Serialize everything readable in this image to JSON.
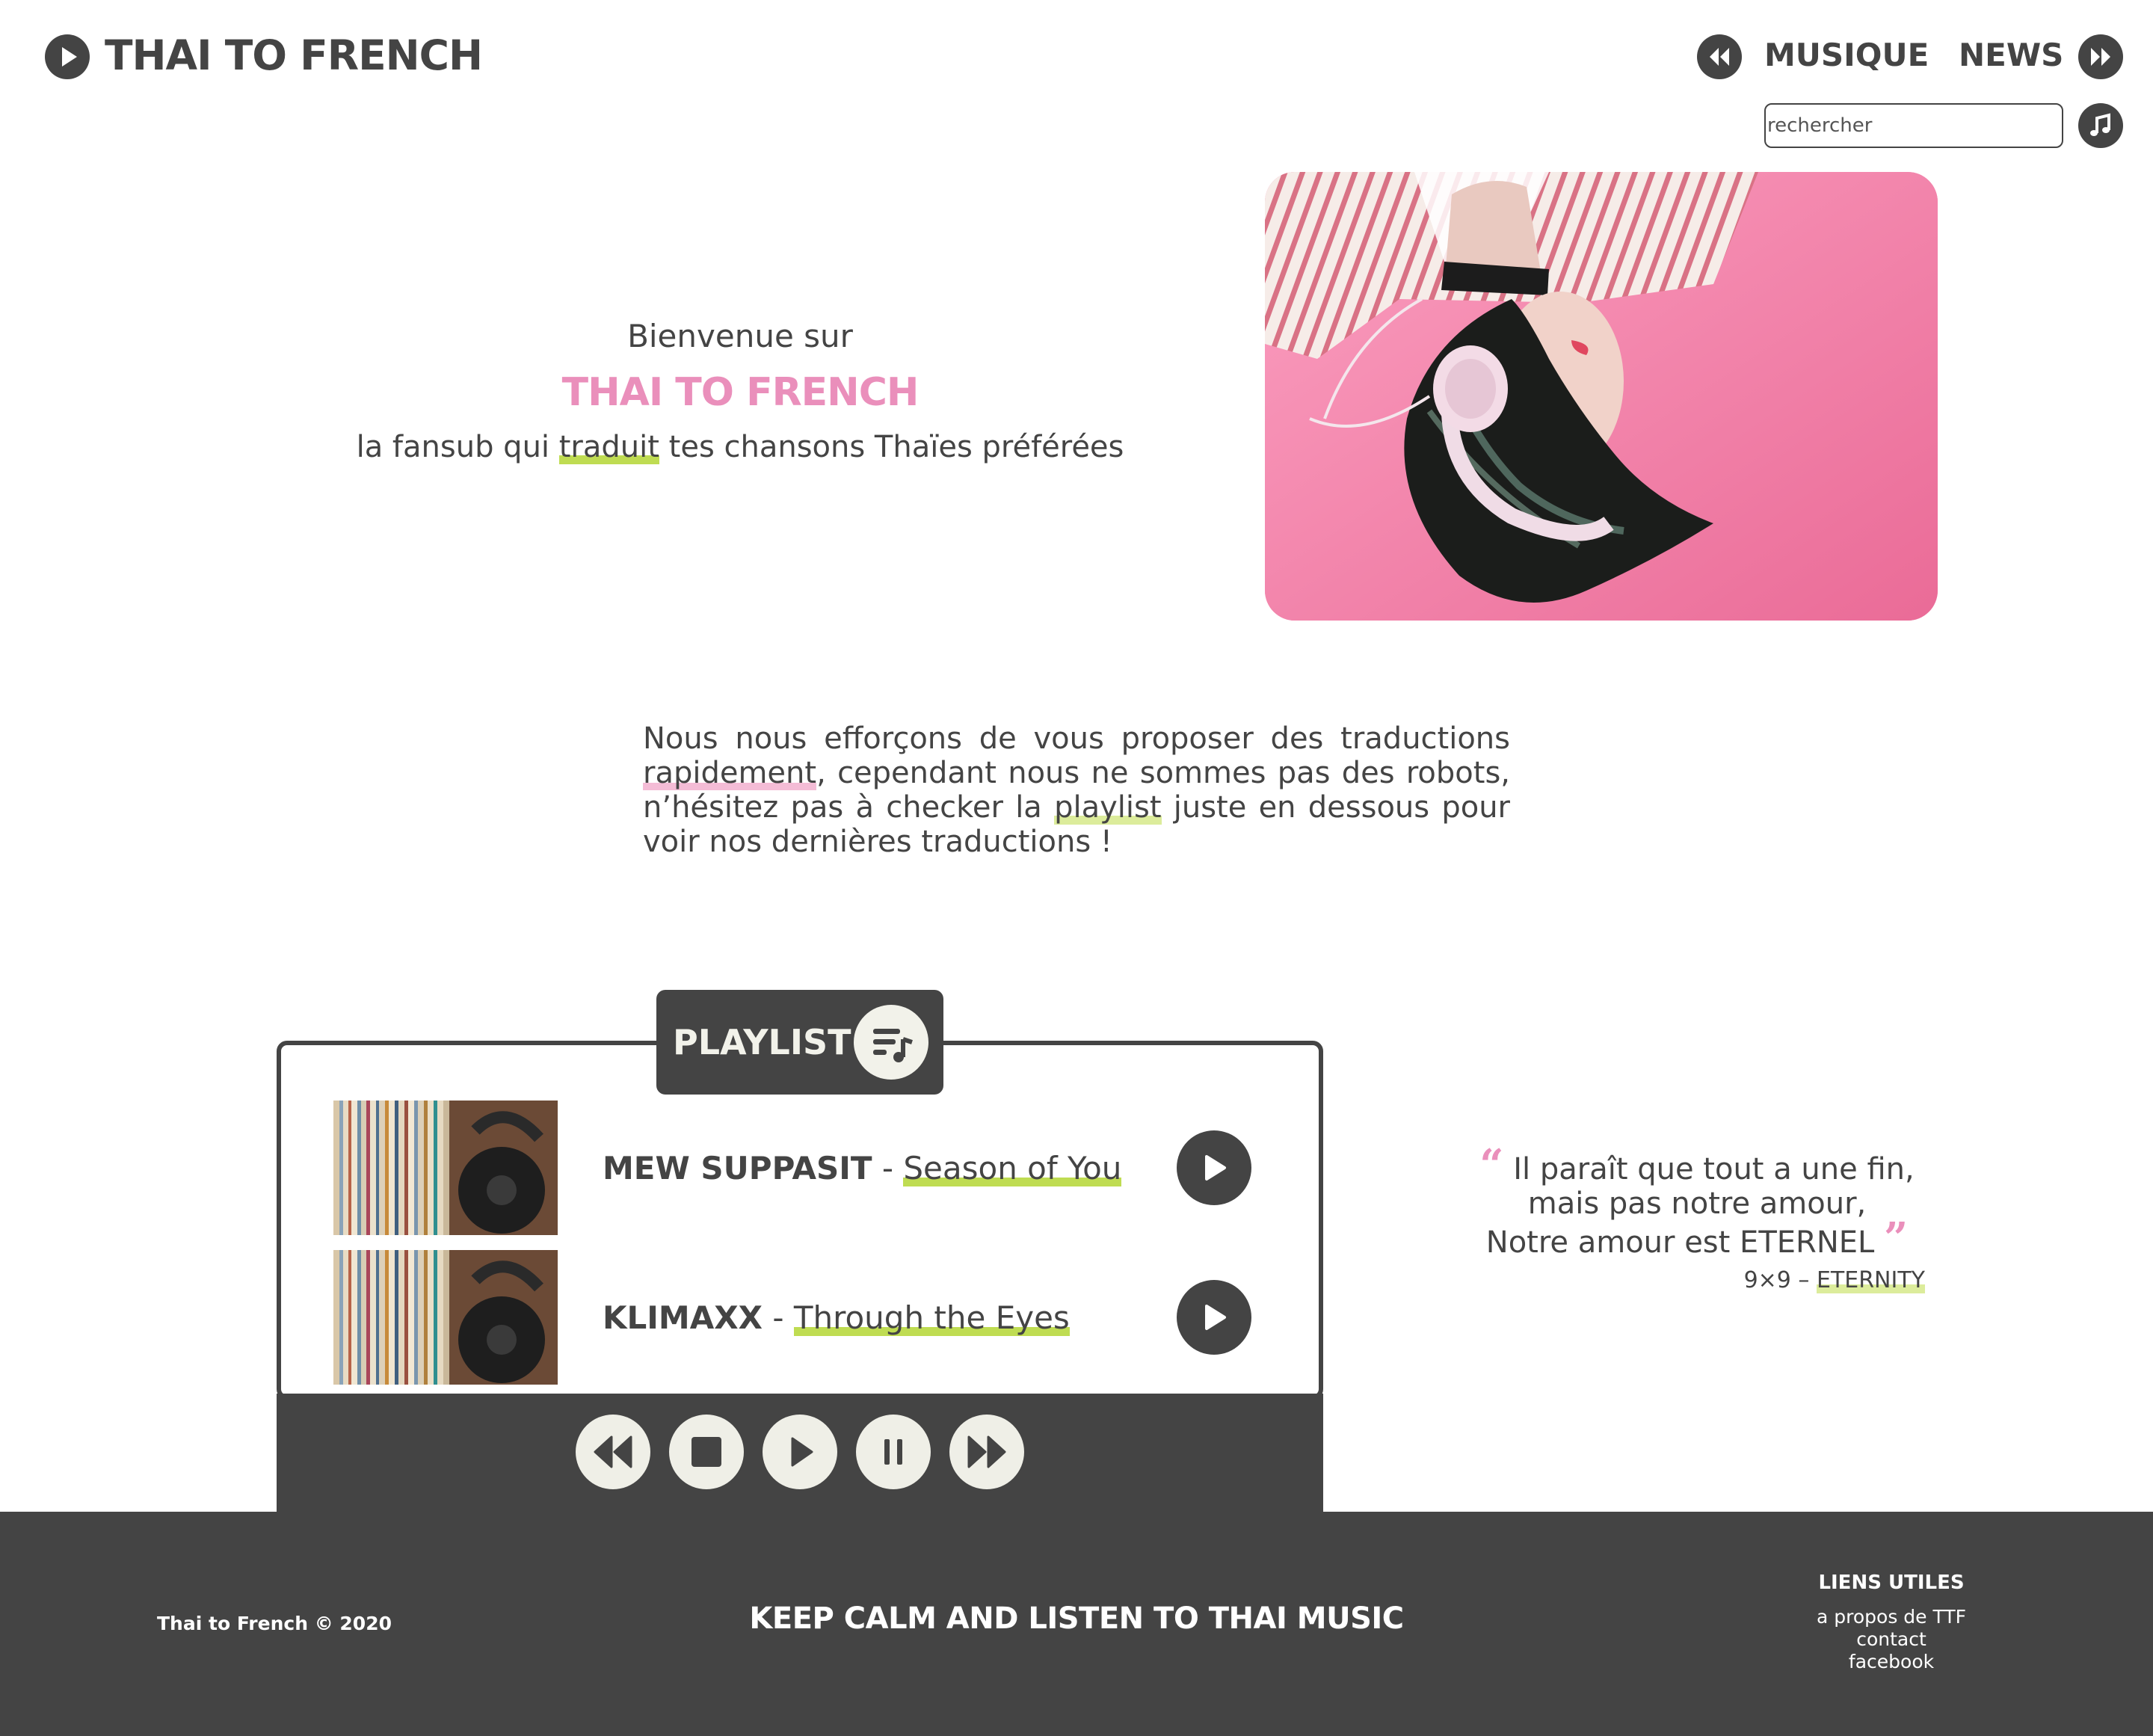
{
  "header": {
    "brand": "THAI TO FRENCH",
    "nav": {
      "music": "MUSIQUE",
      "news": "NEWS"
    },
    "search": {
      "placeholder": "rechercher",
      "value": ""
    }
  },
  "hero": {
    "welcome": "Bienvenue sur",
    "brand": "THAI TO FRENCH",
    "tagline_before": "la fansub qui ",
    "tagline_highlight": "traduit",
    "tagline_after": " tes chansons Thaïes préférées"
  },
  "intro": {
    "part1": "Nous nous efforçons de vous proposer des traductions ",
    "highlight1": "rapidement",
    "part2": ", cependant nous ne sommes pas des robots, n’hésitez pas à checker la ",
    "highlight2": "playlist",
    "part3": " juste en dessous pour voir nos dernières traductions !"
  },
  "playlist": {
    "label": "PLAYLIST",
    "tracks": [
      {
        "artist": "MEW SUPPASIT",
        "separator": " - ",
        "title": "Season of You"
      },
      {
        "artist": "KLIMAXX",
        "separator": " - ",
        "title": "Through the Eyes"
      }
    ],
    "controls": [
      "rewind-icon",
      "stop-icon",
      "play-icon",
      "pause-icon",
      "fast-forward-icon"
    ]
  },
  "quote": {
    "line1": "Il paraît que tout a une fin,",
    "line2": "mais pas notre amour,",
    "line3": "Notre amour est ETERNEL",
    "source_prefix": "9×9 – ",
    "source_song": "ETERNITY"
  },
  "footer": {
    "copyright": "Thai to French © 2020",
    "slogan": "KEEP CALM AND LISTEN TO THAI MUSIC",
    "links_title": "LIENS UTILES",
    "links": [
      "a propos de TTF",
      "contact",
      "facebook"
    ]
  },
  "colors": {
    "dark": "#444444",
    "pink": "#ea8fbb",
    "green_highlight": "#bfdc52",
    "cream": "#efefe7"
  }
}
